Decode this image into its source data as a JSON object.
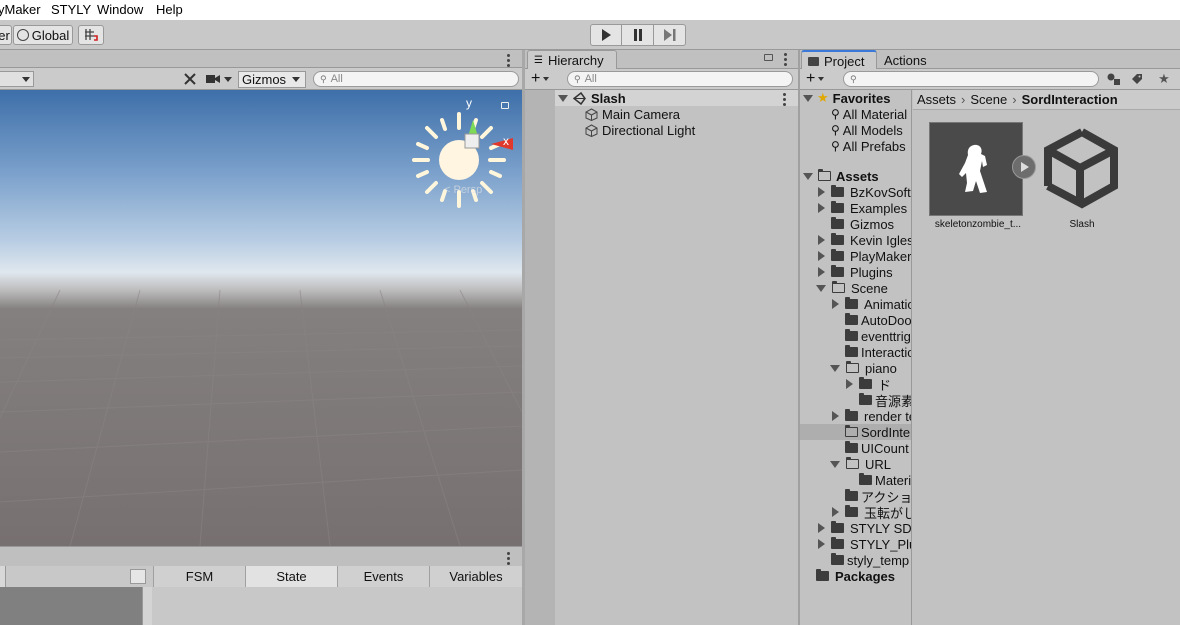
{
  "menubar": {
    "items": [
      "yMaker",
      "STYLY",
      "Window",
      "Help"
    ]
  },
  "toolbar": {
    "pivot_label": "er",
    "global_label": "Global"
  },
  "scene": {
    "gizmos_label": "Gizmos",
    "search_placeholder": "All",
    "persp_label": "< Persp",
    "axis_y": "y",
    "axis_x": "x"
  },
  "hierarchy": {
    "tab_label": "Hierarchy",
    "search_placeholder": "All",
    "add_label": "+",
    "items": [
      {
        "label": "Slash"
      },
      {
        "label": "Main Camera"
      },
      {
        "label": "Directional Light"
      }
    ]
  },
  "project": {
    "tab_label": "Project",
    "actions_tab_label": "Actions",
    "add_label": "+",
    "breadcrumb": [
      "Assets",
      "Scene",
      "SordInteraction"
    ],
    "favorites": {
      "label": "Favorites",
      "items": [
        "All Material",
        "All Models",
        "All Prefabs"
      ]
    },
    "tree": [
      {
        "label": "Assets"
      },
      {
        "label": "BzKovSoft"
      },
      {
        "label": "Examples"
      },
      {
        "label": "Gizmos"
      },
      {
        "label": "Kevin Iglesi"
      },
      {
        "label": "PlayMaker"
      },
      {
        "label": "Plugins"
      },
      {
        "label": "Scene"
      },
      {
        "label": "Animatio"
      },
      {
        "label": "AutoDoo"
      },
      {
        "label": "eventtrig"
      },
      {
        "label": "Interactic"
      },
      {
        "label": "piano"
      },
      {
        "label": "ド"
      },
      {
        "label": "音源素"
      },
      {
        "label": "render te"
      },
      {
        "label": "SordInter"
      },
      {
        "label": "UICount"
      },
      {
        "label": "URL"
      },
      {
        "label": "Materi"
      },
      {
        "label": "アクショ"
      },
      {
        "label": "玉転がし"
      },
      {
        "label": "STYLY SDK"
      },
      {
        "label": "STYLY_Plu"
      },
      {
        "label": "styly_temp"
      },
      {
        "label": "Packages"
      }
    ],
    "assets": [
      {
        "label": "skeletonzombie_t..."
      },
      {
        "label": "Slash"
      }
    ]
  },
  "playmaker": {
    "tabs": [
      "FSM",
      "State",
      "Events",
      "Variables"
    ]
  }
}
